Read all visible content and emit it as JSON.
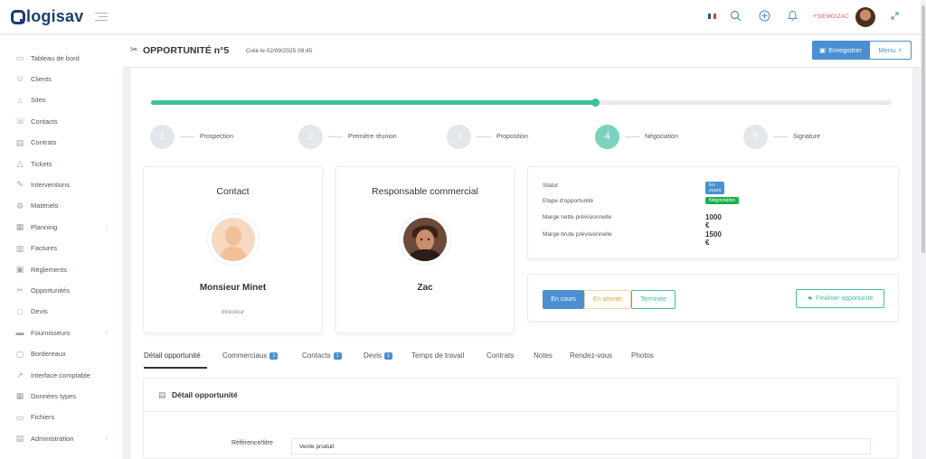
{
  "app": {
    "name": "logisav"
  },
  "topbar": {
    "user_label": "DEMO\\ZAC"
  },
  "sidebar": {
    "items": [
      {
        "label": "Tableau de bord",
        "icon": "dashboard-icon",
        "chevron": false
      },
      {
        "label": "Clients",
        "icon": "users-icon",
        "chevron": false
      },
      {
        "label": "Sites",
        "icon": "location-icon",
        "chevron": false
      },
      {
        "label": "Contacts",
        "icon": "contact-icon",
        "chevron": false
      },
      {
        "label": "Contrats",
        "icon": "contract-icon",
        "chevron": false
      },
      {
        "label": "Tickets",
        "icon": "warning-icon",
        "chevron": false
      },
      {
        "label": "Interventions",
        "icon": "wrench-icon",
        "chevron": false
      },
      {
        "label": "Matériels",
        "icon": "gear-icon",
        "chevron": false
      },
      {
        "label": "Planning",
        "icon": "calendar-icon",
        "chevron": true
      },
      {
        "label": "Factures",
        "icon": "invoice-icon",
        "chevron": false
      },
      {
        "label": "Règlements",
        "icon": "payment-icon",
        "chevron": false
      },
      {
        "label": "Opportunités",
        "icon": "handshake-icon",
        "chevron": false
      },
      {
        "label": "Devis",
        "icon": "quote-icon",
        "chevron": false
      },
      {
        "label": "Fournisseurs",
        "icon": "truck-icon",
        "chevron": true
      },
      {
        "label": "Bordereaux",
        "icon": "folder-icon",
        "chevron": false
      },
      {
        "label": "Interface comptable",
        "icon": "external-link-icon",
        "chevron": false
      },
      {
        "label": "Données types",
        "icon": "grid-icon",
        "chevron": false
      },
      {
        "label": "Fichiers",
        "icon": "file-icon",
        "chevron": false
      },
      {
        "label": "Administration",
        "icon": "admin-icon",
        "chevron": true
      }
    ]
  },
  "header": {
    "title": "OPPORTUNITÉ n°5",
    "created": "Créé le 02/09/2025 09:45",
    "save_label": "Enregistrer",
    "menu_label": "Menu"
  },
  "progress": {
    "value": 0.6
  },
  "steps": [
    {
      "num": "1",
      "label": "Prospection"
    },
    {
      "num": "2",
      "label": "Première réunion"
    },
    {
      "num": "3",
      "label": "Proposition"
    },
    {
      "num": "4",
      "label": "Négociation"
    },
    {
      "num": "5",
      "label": "Signature"
    }
  ],
  "contact": {
    "title": "Contact",
    "name": "Monsieur Minet",
    "role": "directeur"
  },
  "commercial": {
    "title": "Responsable commercial",
    "name": "Zac"
  },
  "status": {
    "statut_label": "Statut",
    "statut_value": "En cours",
    "etape_label": "Etape d'opportunité",
    "etape_value": "Négociation",
    "marge_nette_label": "Marge nette prévisionnelle",
    "marge_nette_value": "1000 €",
    "marge_brute_label": "Marge brute prévisionnelle",
    "marge_brute_value": "1500 €"
  },
  "state_buttons": {
    "en_cours": "En cours",
    "en_attente": "En attente",
    "terminee": "Terminée",
    "finalize": "Finaliser opportunité"
  },
  "tabs": [
    {
      "label": "Détail opportunité",
      "count": ""
    },
    {
      "label": "Commerciaux",
      "count": "1"
    },
    {
      "label": "Contacts",
      "count": "1"
    },
    {
      "label": "Devis",
      "count": "1"
    },
    {
      "label": "Temps de travail",
      "count": ""
    },
    {
      "label": "Contrats",
      "count": ""
    },
    {
      "label": "Notes",
      "count": ""
    },
    {
      "label": "Rendez-vous",
      "count": ""
    },
    {
      "label": "Photos",
      "count": ""
    }
  ],
  "detail": {
    "title": "Détail opportunité",
    "ref_label": "Référence/titre",
    "ref_value": "Vente produit"
  },
  "colors": {
    "brand": "#1d3d73",
    "accent": "#4b8fd0",
    "success": "#3fbf9a",
    "warning": "#f0a63a"
  }
}
